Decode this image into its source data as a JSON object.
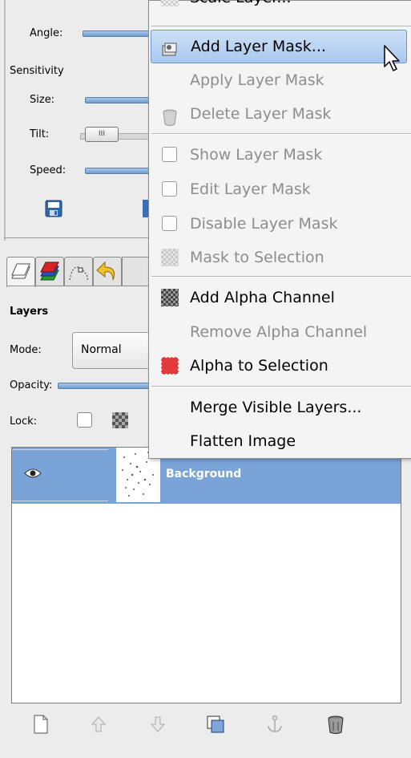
{
  "tool_options": {
    "angle_label": "Angle:",
    "sensitivity_label": "Sensitivity",
    "size_label": "Size:",
    "tilt_label": "Tilt:",
    "speed_label": "Speed:"
  },
  "layers_dock": {
    "title": "Layers",
    "mode_label": "Mode:",
    "mode_value": "Normal",
    "opacity_label": "Opacity:",
    "lock_label": "Lock:",
    "layers": [
      {
        "name": "Background",
        "visible": true,
        "selected": true
      }
    ]
  },
  "context_menu": {
    "partial_top_item": "Scale Layer...",
    "items": [
      {
        "label": "Add Layer Mask...",
        "state": "highlighted",
        "icon": "add-mask-icon"
      },
      {
        "label": "Apply Layer Mask",
        "state": "disabled",
        "icon": ""
      },
      {
        "label": "Delete Layer Mask",
        "state": "disabled",
        "icon": "delete-mask-icon"
      },
      {
        "label": "Show Layer Mask",
        "state": "disabled",
        "icon": "checkbox"
      },
      {
        "label": "Edit Layer Mask",
        "state": "disabled",
        "icon": "checkbox"
      },
      {
        "label": "Disable Layer Mask",
        "state": "disabled",
        "icon": "checkbox"
      },
      {
        "label": "Mask to Selection",
        "state": "disabled",
        "icon": "mask-to-selection-icon"
      },
      {
        "label": "Add Alpha Channel",
        "state": "enabled",
        "icon": "alpha-channel-icon"
      },
      {
        "label": "Remove Alpha Channel",
        "state": "disabled",
        "icon": ""
      },
      {
        "label": "Alpha to Selection",
        "state": "enabled",
        "icon": "alpha-to-selection-icon"
      },
      {
        "label": "Merge Visible Layers...",
        "state": "enabled",
        "icon": ""
      },
      {
        "label": "Flatten Image",
        "state": "enabled",
        "icon": ""
      }
    ]
  },
  "colors": {
    "highlight": "#a9c8ee",
    "selected_layer": "#7aa3d7",
    "disabled_text": "#8d8d8d"
  }
}
